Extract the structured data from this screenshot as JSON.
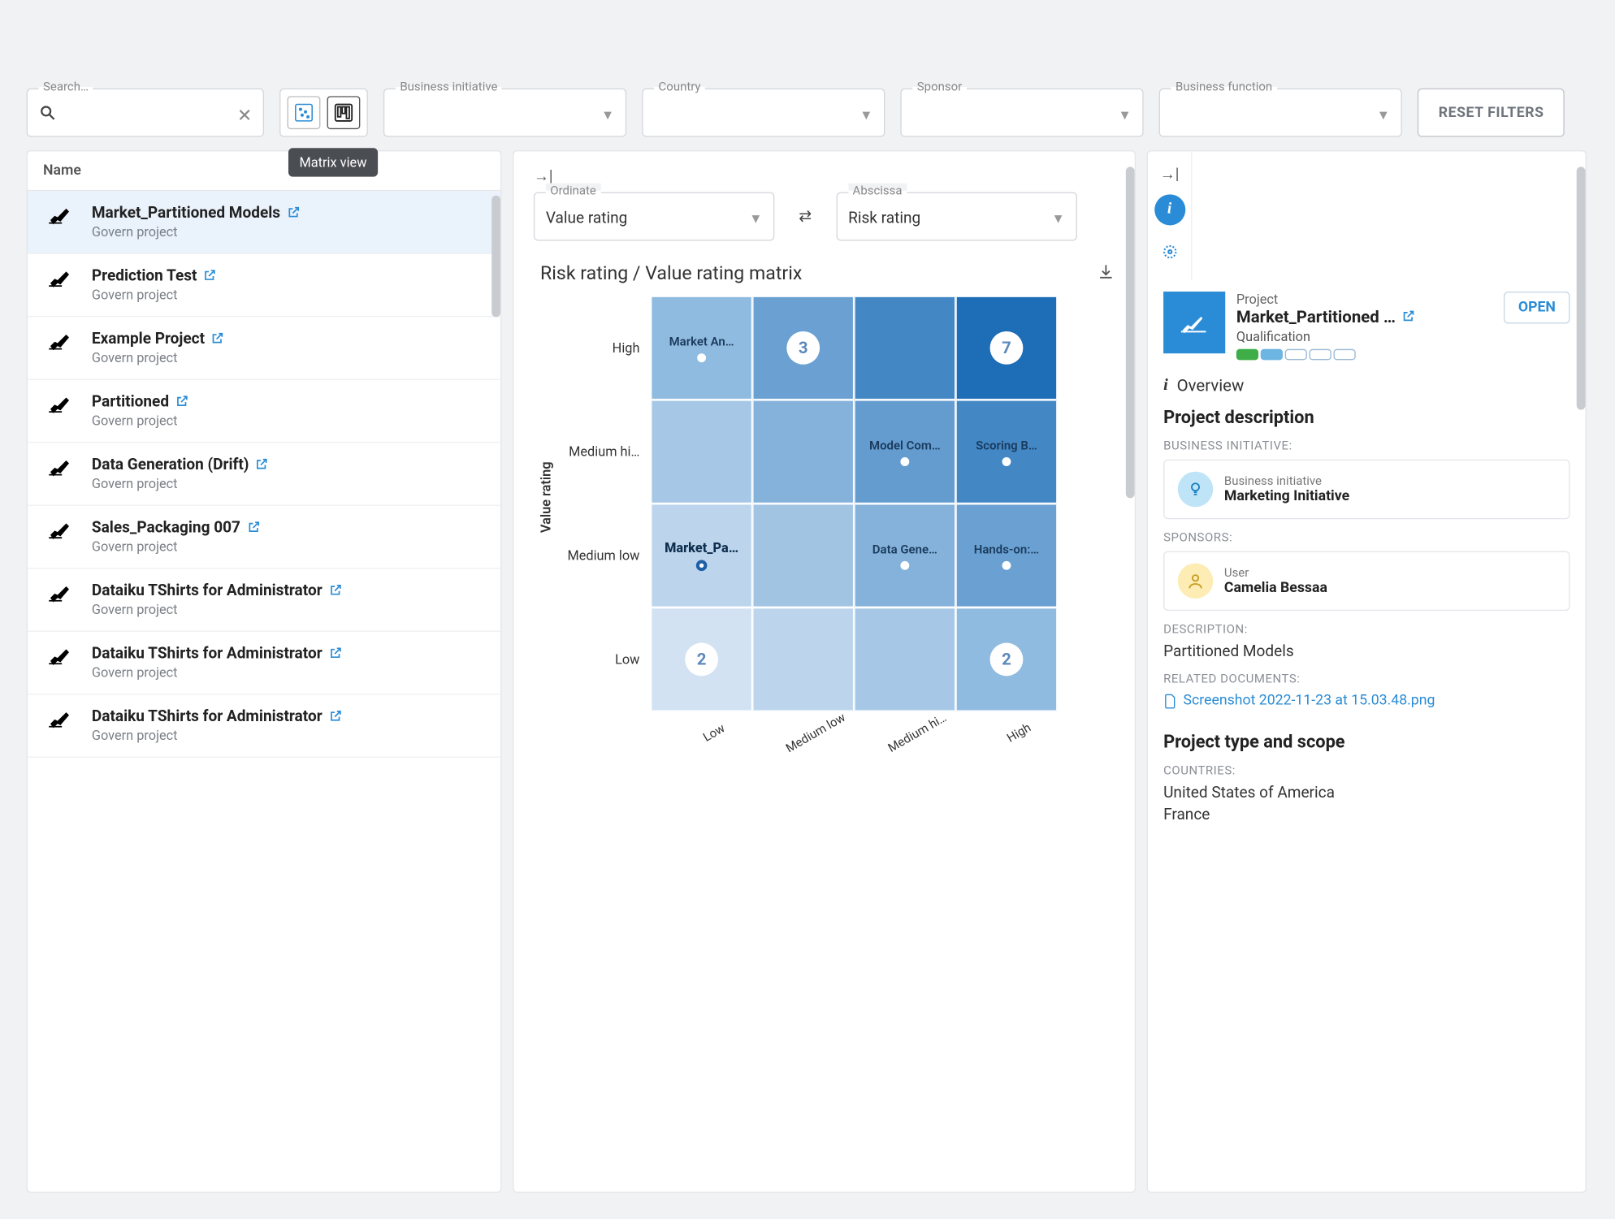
{
  "topbar": {
    "search_legend": "Search…",
    "tooltip": "Matrix view",
    "reset_label": "RESET FILTERS",
    "filters": [
      {
        "legend": "Business initiative"
      },
      {
        "legend": "Country"
      },
      {
        "legend": "Sponsor"
      },
      {
        "legend": "Business function"
      }
    ]
  },
  "left": {
    "header": "Name",
    "items": [
      {
        "title": "Market_Partitioned Models",
        "sub": "Govern project",
        "selected": true
      },
      {
        "title": "Prediction Test",
        "sub": "Govern project"
      },
      {
        "title": "Example Project",
        "sub": "Govern project"
      },
      {
        "title": "Partitioned",
        "sub": "Govern project"
      },
      {
        "title": "Data Generation (Drift)",
        "sub": "Govern project"
      },
      {
        "title": "Sales_Packaging 007",
        "sub": "Govern project"
      },
      {
        "title": "Dataiku TShirts for Administrator",
        "sub": "Govern project"
      },
      {
        "title": "Dataiku TShirts for Administrator",
        "sub": "Govern project"
      },
      {
        "title": "Dataiku TShirts for Administrator",
        "sub": "Govern project"
      }
    ]
  },
  "matrix": {
    "ordinate_legend": "Ordinate",
    "ordinate_value": "Value rating",
    "abscissa_legend": "Abscissa",
    "abscissa_value": "Risk rating",
    "title": "Risk rating / Value rating matrix",
    "ylabel": "Value rating",
    "rows": [
      "High",
      "Medium hi…",
      "Medium low",
      "Low"
    ],
    "cols": [
      "Low",
      "Medium low",
      "Medium hi…",
      "High"
    ],
    "cells": {
      "r0c0": {
        "label": "Market An…",
        "dot": "small"
      },
      "r0c1": {
        "count": "3"
      },
      "r0c3": {
        "count": "7"
      },
      "r1c2": {
        "label": "Model Com…",
        "dot": "small"
      },
      "r1c3": {
        "label": "Scoring B…",
        "dot": "small"
      },
      "r2c0": {
        "label": "Market_Pa…",
        "dot": "hollow"
      },
      "r2c2": {
        "label": "Data Gene…",
        "dot": "small"
      },
      "r2c3": {
        "label": "Hands-on:…",
        "dot": "small"
      },
      "r3c0": {
        "count": "2"
      },
      "r3c3": {
        "count": "2"
      }
    }
  },
  "right": {
    "type_label": "Project",
    "name": "Market_Partitioned …",
    "open_label": "OPEN",
    "phase": "Qualification",
    "overview_label": "Overview",
    "desc_heading": "Project description",
    "biz_label": "BUSINESS INITIATIVE:",
    "biz_card_sm": "Business initiative",
    "biz_card_bg": "Marketing Initiative",
    "sponsors_label": "SPONSORS:",
    "sponsor_sm": "User",
    "sponsor_bg": "Camelia Bessaa",
    "description_label": "DESCRIPTION:",
    "description_value": "Partitioned Models",
    "related_label": "RELATED DOCUMENTS:",
    "related_link": "Screenshot 2022-11-23 at 15.03.48.png",
    "scope_heading": "Project type and scope",
    "countries_label": "COUNTRIES:",
    "countries": [
      "United States of America",
      "France"
    ]
  },
  "chart_data": {
    "type": "heatmap",
    "title": "Risk rating / Value rating matrix",
    "xlabel": "Risk rating",
    "ylabel": "Value rating",
    "x_categories": [
      "Low",
      "Medium low",
      "Medium high",
      "High"
    ],
    "y_categories": [
      "High",
      "Medium high",
      "Medium low",
      "Low"
    ],
    "grid": [
      [
        {
          "items": [
            "Market An…"
          ]
        },
        {
          "count": 3
        },
        null,
        {
          "count": 7
        }
      ],
      [
        null,
        null,
        {
          "items": [
            "Model Com…"
          ]
        },
        {
          "items": [
            "Scoring B…"
          ]
        }
      ],
      [
        {
          "items": [
            "Market_Pa…"
          ],
          "highlighted": true
        },
        null,
        {
          "items": [
            "Data Gene…"
          ]
        },
        {
          "items": [
            "Hands-on:…"
          ]
        }
      ],
      [
        {
          "count": 2
        },
        null,
        null,
        {
          "count": 2
        }
      ]
    ]
  }
}
